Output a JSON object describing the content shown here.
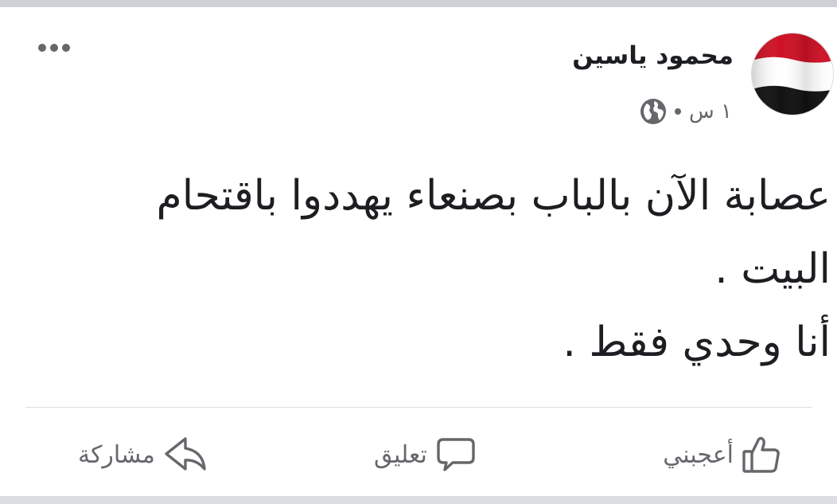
{
  "post": {
    "author": "محمود ياسين",
    "time": "١ س",
    "text_lines": [
      "عصابة الآن بالباب بصنعاء  يهددوا باقتحام",
      "البيت .",
      "أنا وحدي فقط ."
    ]
  },
  "actions": {
    "like_label": "أعجبني",
    "comment_label": "تعليق",
    "share_label": "مشاركة"
  },
  "icons": {
    "avatar": "yemen-flag",
    "privacy": "globe-icon",
    "more": "ellipsis-icon",
    "like": "thumbs-up-icon",
    "comment": "speech-bubble-icon",
    "share": "share-arrow-icon"
  },
  "colors": {
    "text": "#1c1e21",
    "secondary": "#65676b",
    "flag_red": "#ce1126",
    "flag_white": "#ffffff",
    "flag_black": "#000000"
  }
}
